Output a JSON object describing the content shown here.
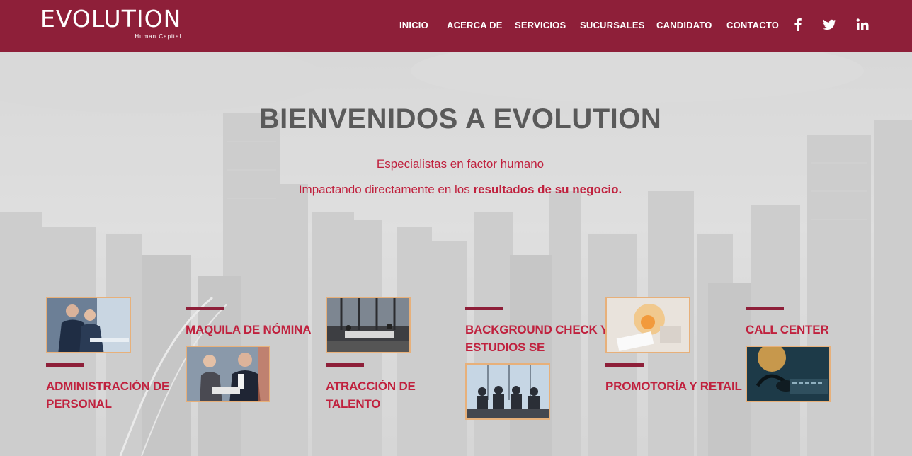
{
  "brand": {
    "name": "EVOLUTION",
    "tagline": "Human Capital",
    "color": "#8e1f39",
    "accent": "#c0213e"
  },
  "nav": {
    "items": [
      {
        "label": "INICIO"
      },
      {
        "label": "ACERCA DE"
      },
      {
        "label": "SERVICIOS"
      },
      {
        "label": "SUCURSALES"
      },
      {
        "label": "CANDIDATO"
      },
      {
        "label": "CONTACTO"
      }
    ],
    "social": [
      {
        "icon": "facebook-icon"
      },
      {
        "icon": "twitter-icon"
      },
      {
        "icon": "linkedin-icon"
      }
    ]
  },
  "hero": {
    "title": "BIENVENIDOS A EVOLUTION",
    "subtitle": "Especialistas en factor humano",
    "line2_prefix": "Impactando directamente en los ",
    "line2_bold": "resultados de su negocio."
  },
  "services": [
    {
      "label_line1": "ADMINISTRACIÓN DE",
      "label_line2": "PERSONAL",
      "image": "business-meeting-image"
    },
    {
      "label_line1": "MAQUILA DE NÓMINA",
      "label_line2": "",
      "image": "team-review-image"
    },
    {
      "label_line1": "ATRACCIÓN DE",
      "label_line2": "TALENTO",
      "image": "office-room-image"
    },
    {
      "label_line1": "BACKGROUND CHECK Y",
      "label_line2": "ESTUDIOS SE",
      "image": "boardroom-image"
    },
    {
      "label_line1": "PROMOTORÍA Y RETAIL",
      "label_line2": "",
      "image": "retail-payment-image"
    },
    {
      "label_line1": "CALL CENTER",
      "label_line2": "",
      "image": "headset-image"
    }
  ]
}
